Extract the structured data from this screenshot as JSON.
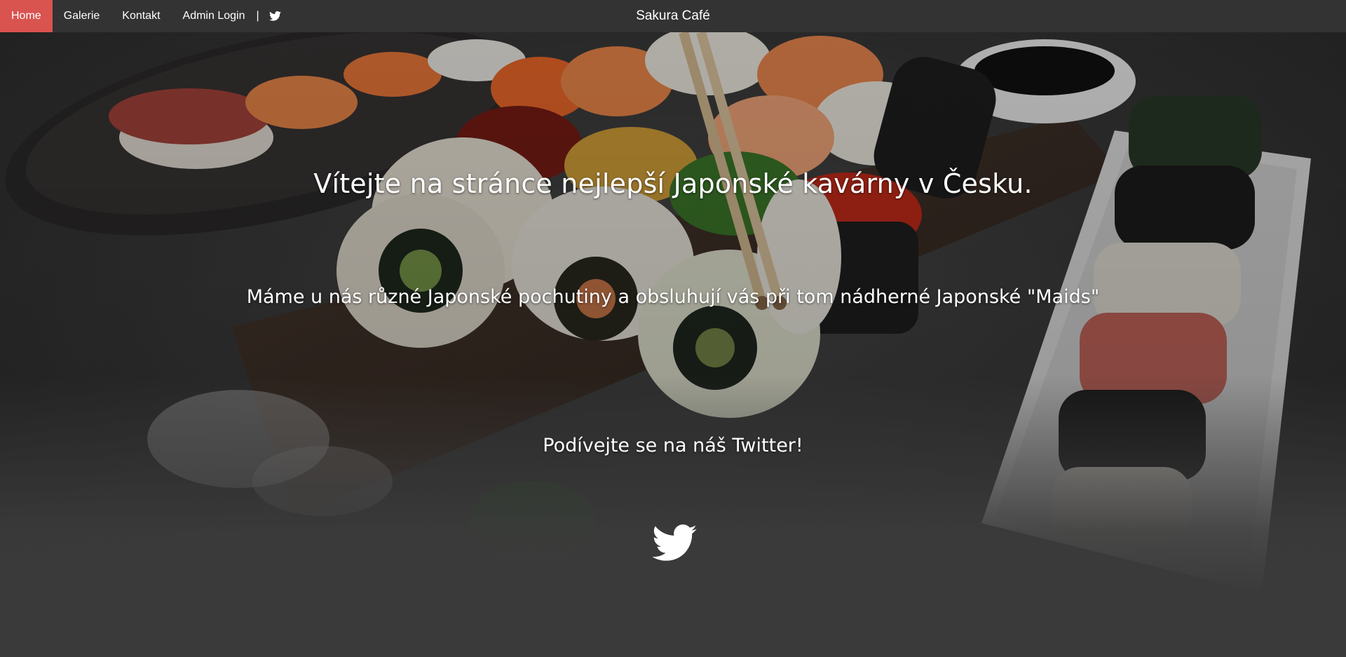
{
  "nav": {
    "items": [
      {
        "label": "Home",
        "active": true
      },
      {
        "label": "Galerie",
        "active": false
      },
      {
        "label": "Kontakt",
        "active": false
      },
      {
        "label": "Admin Login",
        "active": false
      }
    ],
    "separator": "|",
    "twitter_icon": "twitter-icon"
  },
  "brand": {
    "title": "Sakura Café"
  },
  "hero": {
    "welcome": "Vítejte na stránce nejlepší Japonské kavárny v Česku.",
    "tagline": "Máme u nás různé Japonské pochutiny a obsluhují vás při tom nádherné Japonské \"Maids\"",
    "twitter_cta": "Podívejte se na náš Twitter!",
    "twitter_icon": "twitter-icon"
  },
  "colors": {
    "navbar_bg": "#333333",
    "active_nav": "#d9534f",
    "page_bg": "#3a3a3a",
    "text": "#ffffff"
  }
}
